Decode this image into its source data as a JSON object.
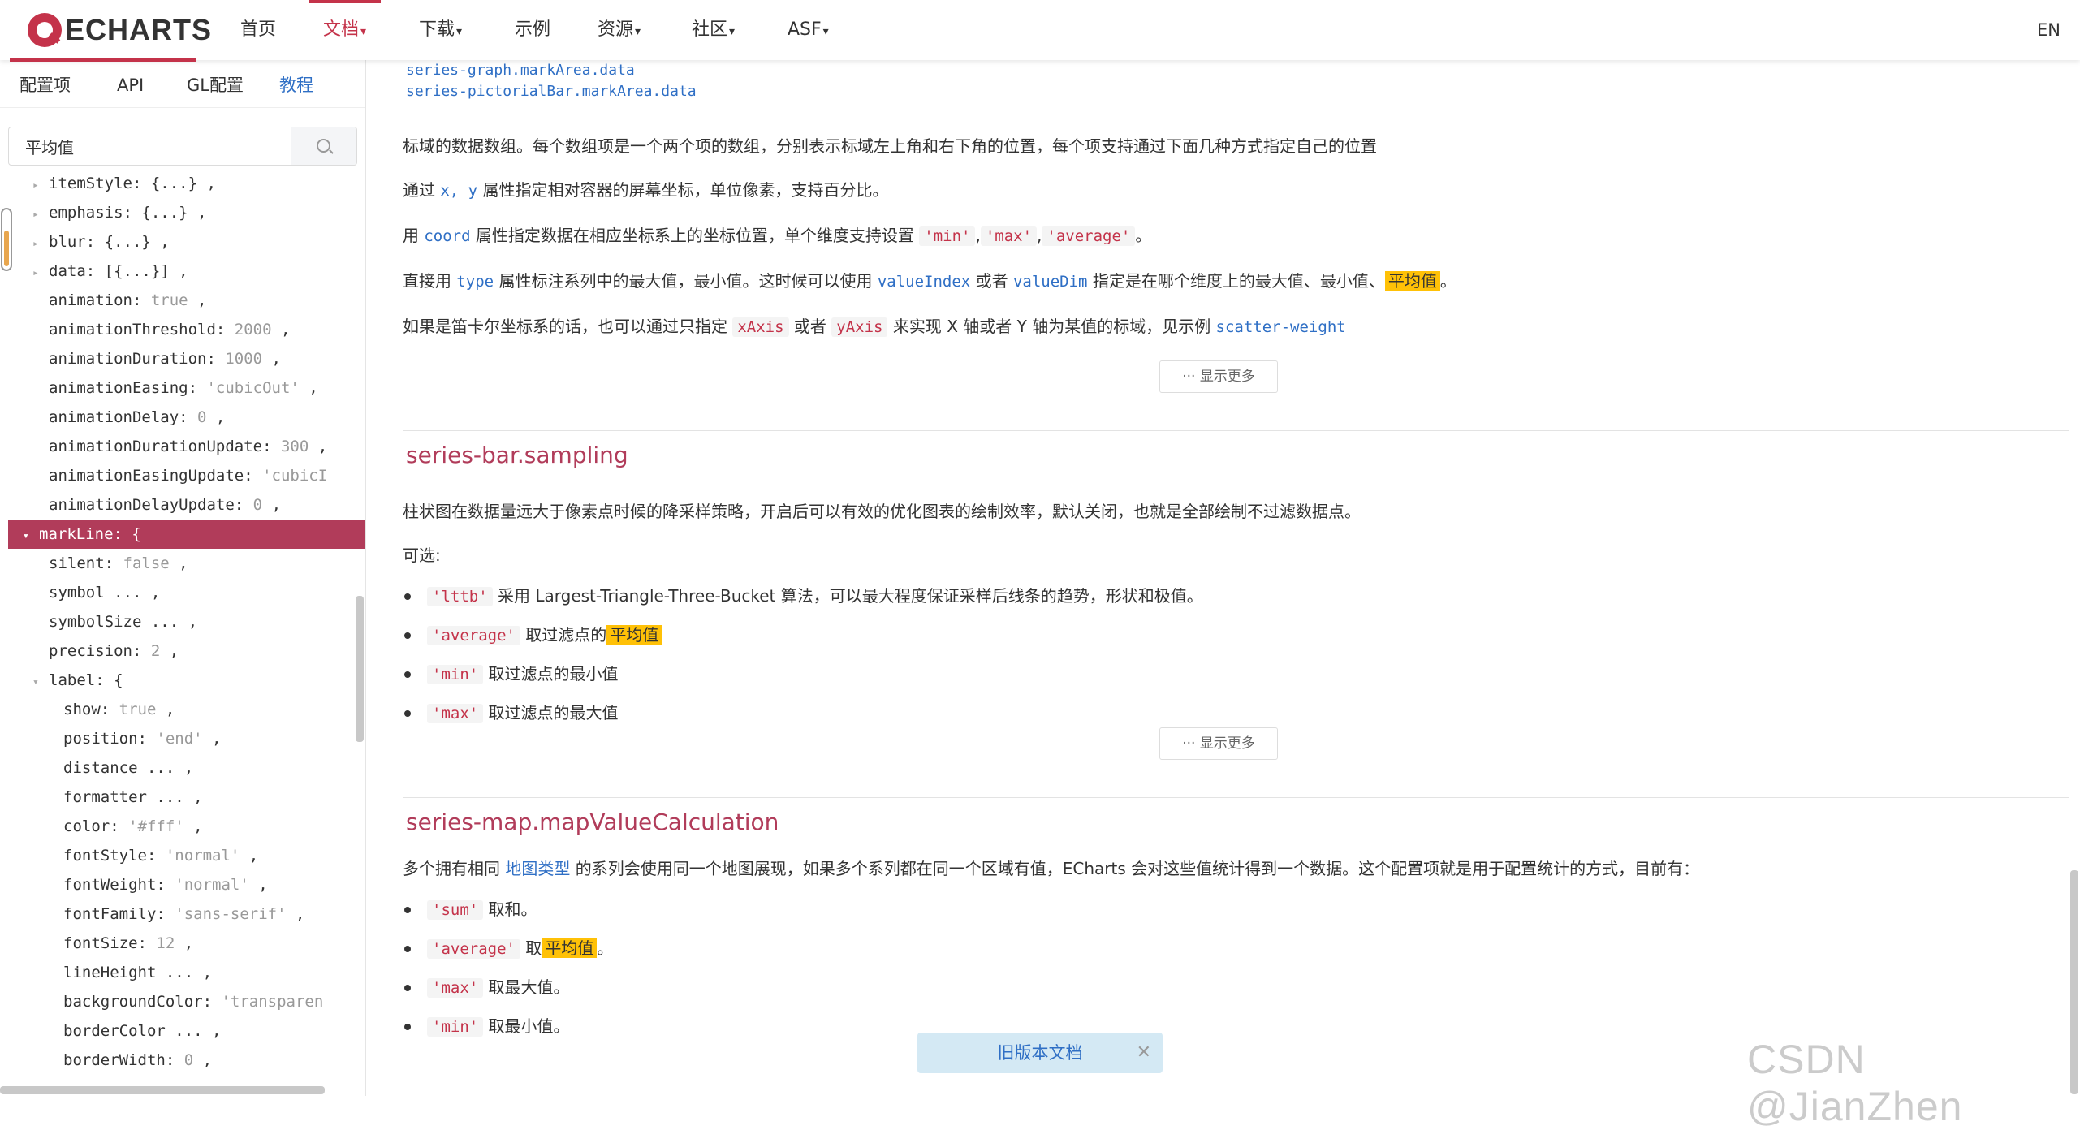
{
  "nav": {
    "logo": "ECHARTS",
    "items": [
      {
        "label": "首页",
        "caret": ""
      },
      {
        "label": "文档",
        "caret": "▾"
      },
      {
        "label": "下载",
        "caret": "▾"
      },
      {
        "label": "示例",
        "caret": ""
      },
      {
        "label": "资源",
        "caret": "▾"
      },
      {
        "label": "社区",
        "caret": "▾"
      },
      {
        "label": "ASF",
        "caret": "▾"
      }
    ],
    "lang": "EN"
  },
  "sidebar": {
    "tabs": [
      "配置项",
      "API",
      "GL配置",
      "教程"
    ],
    "search_value": "平均值",
    "tree": [
      {
        "arrow": "▸",
        "key": "itemStyle: ",
        "val": "",
        "rest": "{...} ,"
      },
      {
        "arrow": "▸",
        "key": "emphasis: ",
        "val": "",
        "rest": "{...} ,"
      },
      {
        "arrow": "▸",
        "key": "blur: ",
        "val": "",
        "rest": "{...} ,"
      },
      {
        "arrow": "▸",
        "key": "data: ",
        "val": "",
        "rest": "[{...}] ,"
      },
      {
        "arrow": "",
        "key": "animation: ",
        "val": "true",
        "rest": " ,"
      },
      {
        "arrow": "",
        "key": "animationThreshold: ",
        "val": "2000",
        "rest": " ,"
      },
      {
        "arrow": "",
        "key": "animationDuration: ",
        "val": "1000",
        "rest": " ,"
      },
      {
        "arrow": "",
        "key": "animationEasing: ",
        "val": "'cubicOut'",
        "rest": " ,"
      },
      {
        "arrow": "",
        "key": "animationDelay: ",
        "val": "0",
        "rest": " ,"
      },
      {
        "arrow": "",
        "key": "animationDurationUpdate: ",
        "val": "300",
        "rest": " ,"
      },
      {
        "arrow": "",
        "key": "animationEasingUpdate: ",
        "val": "'cubicI",
        "rest": ""
      },
      {
        "arrow": "",
        "key": "animationDelayUpdate: ",
        "val": "0",
        "rest": " ,"
      },
      {
        "arrow": "▾",
        "key": "markLine: {",
        "val": "",
        "rest": "",
        "selected": true
      },
      {
        "arrow": "",
        "key": "silent: ",
        "val": "false",
        "rest": " ,"
      },
      {
        "arrow": "",
        "key": "symbol ",
        "val": "",
        "rest": "... ,"
      },
      {
        "arrow": "",
        "key": "symbolSize ",
        "val": "",
        "rest": "... ,"
      },
      {
        "arrow": "",
        "key": "precision: ",
        "val": "2",
        "rest": " ,"
      },
      {
        "arrow": "▾",
        "key": "label: {",
        "val": "",
        "rest": ""
      },
      {
        "arrow": "",
        "key": "show: ",
        "val": "true",
        "rest": " ,"
      },
      {
        "arrow": "",
        "key": "position: ",
        "val": "'end'",
        "rest": " ,"
      },
      {
        "arrow": "",
        "key": "distance ",
        "val": "",
        "rest": "... ,"
      },
      {
        "arrow": "",
        "key": "formatter ",
        "val": "",
        "rest": "... ,"
      },
      {
        "arrow": "",
        "key": "color: ",
        "val": "'#fff'",
        "rest": " ,"
      },
      {
        "arrow": "",
        "key": "fontStyle: ",
        "val": "'normal'",
        "rest": " ,"
      },
      {
        "arrow": "",
        "key": "fontWeight: ",
        "val": "'normal'",
        "rest": " ,"
      },
      {
        "arrow": "",
        "key": "fontFamily: ",
        "val": "'sans-serif'",
        "rest": " ,"
      },
      {
        "arrow": "",
        "key": "fontSize: ",
        "val": "12",
        "rest": " ,"
      },
      {
        "arrow": "",
        "key": "lineHeight ",
        "val": "",
        "rest": "... ,"
      },
      {
        "arrow": "",
        "key": "backgroundColor: ",
        "val": "'transparen",
        "rest": ""
      },
      {
        "arrow": "",
        "key": "borderColor ",
        "val": "",
        "rest": "... ,"
      },
      {
        "arrow": "",
        "key": "borderWidth: ",
        "val": "0",
        "rest": " ,"
      }
    ]
  },
  "content": {
    "refs": [
      "series-graph.markArea.data",
      "series-pictorialBar.markArea.data"
    ],
    "p1": "标域的数据数组。每个数组项是一个两个项的数组，分别表示标域左上角和右下角的位置，每个项支持通过下面几种方式指定自己的位置",
    "p2": {
      "a": "通过 ",
      "code": "x, y",
      "b": " 属性指定相对容器的屏幕坐标，单位像素，支持百分比。"
    },
    "p3": {
      "a": "用 ",
      "code1": "coord",
      "b": " 属性指定数据在相应坐标系上的坐标位置，单个维度支持设置 ",
      "c_min": "'min'",
      "c_max": "'max'",
      "c_avg": "'average'",
      "end": "。",
      "sep": ","
    },
    "p4": {
      "a": "直接用 ",
      "code1": "type",
      "b": " 属性标注系列中的最大值，最小值。这时候可以使用 ",
      "code2": "valueIndex",
      "c": " 或者 ",
      "code3": "valueDim",
      "d": " 指定是在哪个维度上的最大值、最小值、",
      "hl": "平均值",
      "end": "。"
    },
    "p5": {
      "a": "如果是笛卡尔坐标系的话，也可以通过只指定 ",
      "code1": "xAxis",
      "b": " 或者 ",
      "code2": "yAxis",
      "c": " 来实现 X 轴或者 Y 轴为某值的标域，见示例 ",
      "link": "scatter-weight"
    },
    "more_label": "显示更多",
    "more_icon": "···",
    "sec2": {
      "title": "series-bar.sampling",
      "desc": "柱状图在数据量远大于像素点时候的降采样策略，开启后可以有效的优化图表的绘制效率，默认关闭，也就是全部绘制不过滤数据点。",
      "optional": "可选:",
      "bullets": [
        {
          "code": "'lttb'",
          "text": " 采用 Largest-Triangle-Three-Bucket 算法，可以最大程度保证采样后线条的趋势，形状和极值。",
          "hl": "",
          "end": ""
        },
        {
          "code": "'average'",
          "text": " 取过滤点的",
          "hl": "平均值",
          "end": ""
        },
        {
          "code": "'min'",
          "text": " 取过滤点的最小值",
          "hl": "",
          "end": ""
        },
        {
          "code": "'max'",
          "text": " 取过滤点的最大值",
          "hl": "",
          "end": ""
        }
      ]
    },
    "sec3": {
      "title": "series-map.mapValueCalculation",
      "desc_a": "多个拥有相同 ",
      "desc_link": "地图类型",
      "desc_b": " 的系列会使用同一个地图展现，如果多个系列都在同一个区域有值，ECharts 会对这些值统计得到一个数据。这个配置项就是用于配置统计的方式，目前有：",
      "bullets": [
        {
          "code": "'sum'",
          "text": " 取和。",
          "hl": "",
          "end": ""
        },
        {
          "code": "'average'",
          "text": " 取",
          "hl": "平均值",
          "end": "。"
        },
        {
          "code": "'max'",
          "text": " 取最大值。",
          "hl": "",
          "end": ""
        },
        {
          "code": "'min'",
          "text": " 取最小值。",
          "hl": "",
          "end": ""
        }
      ]
    }
  },
  "old_doc": {
    "label": "旧版本文档",
    "close": "✕"
  },
  "watermark": "CSDN @JianZhen"
}
